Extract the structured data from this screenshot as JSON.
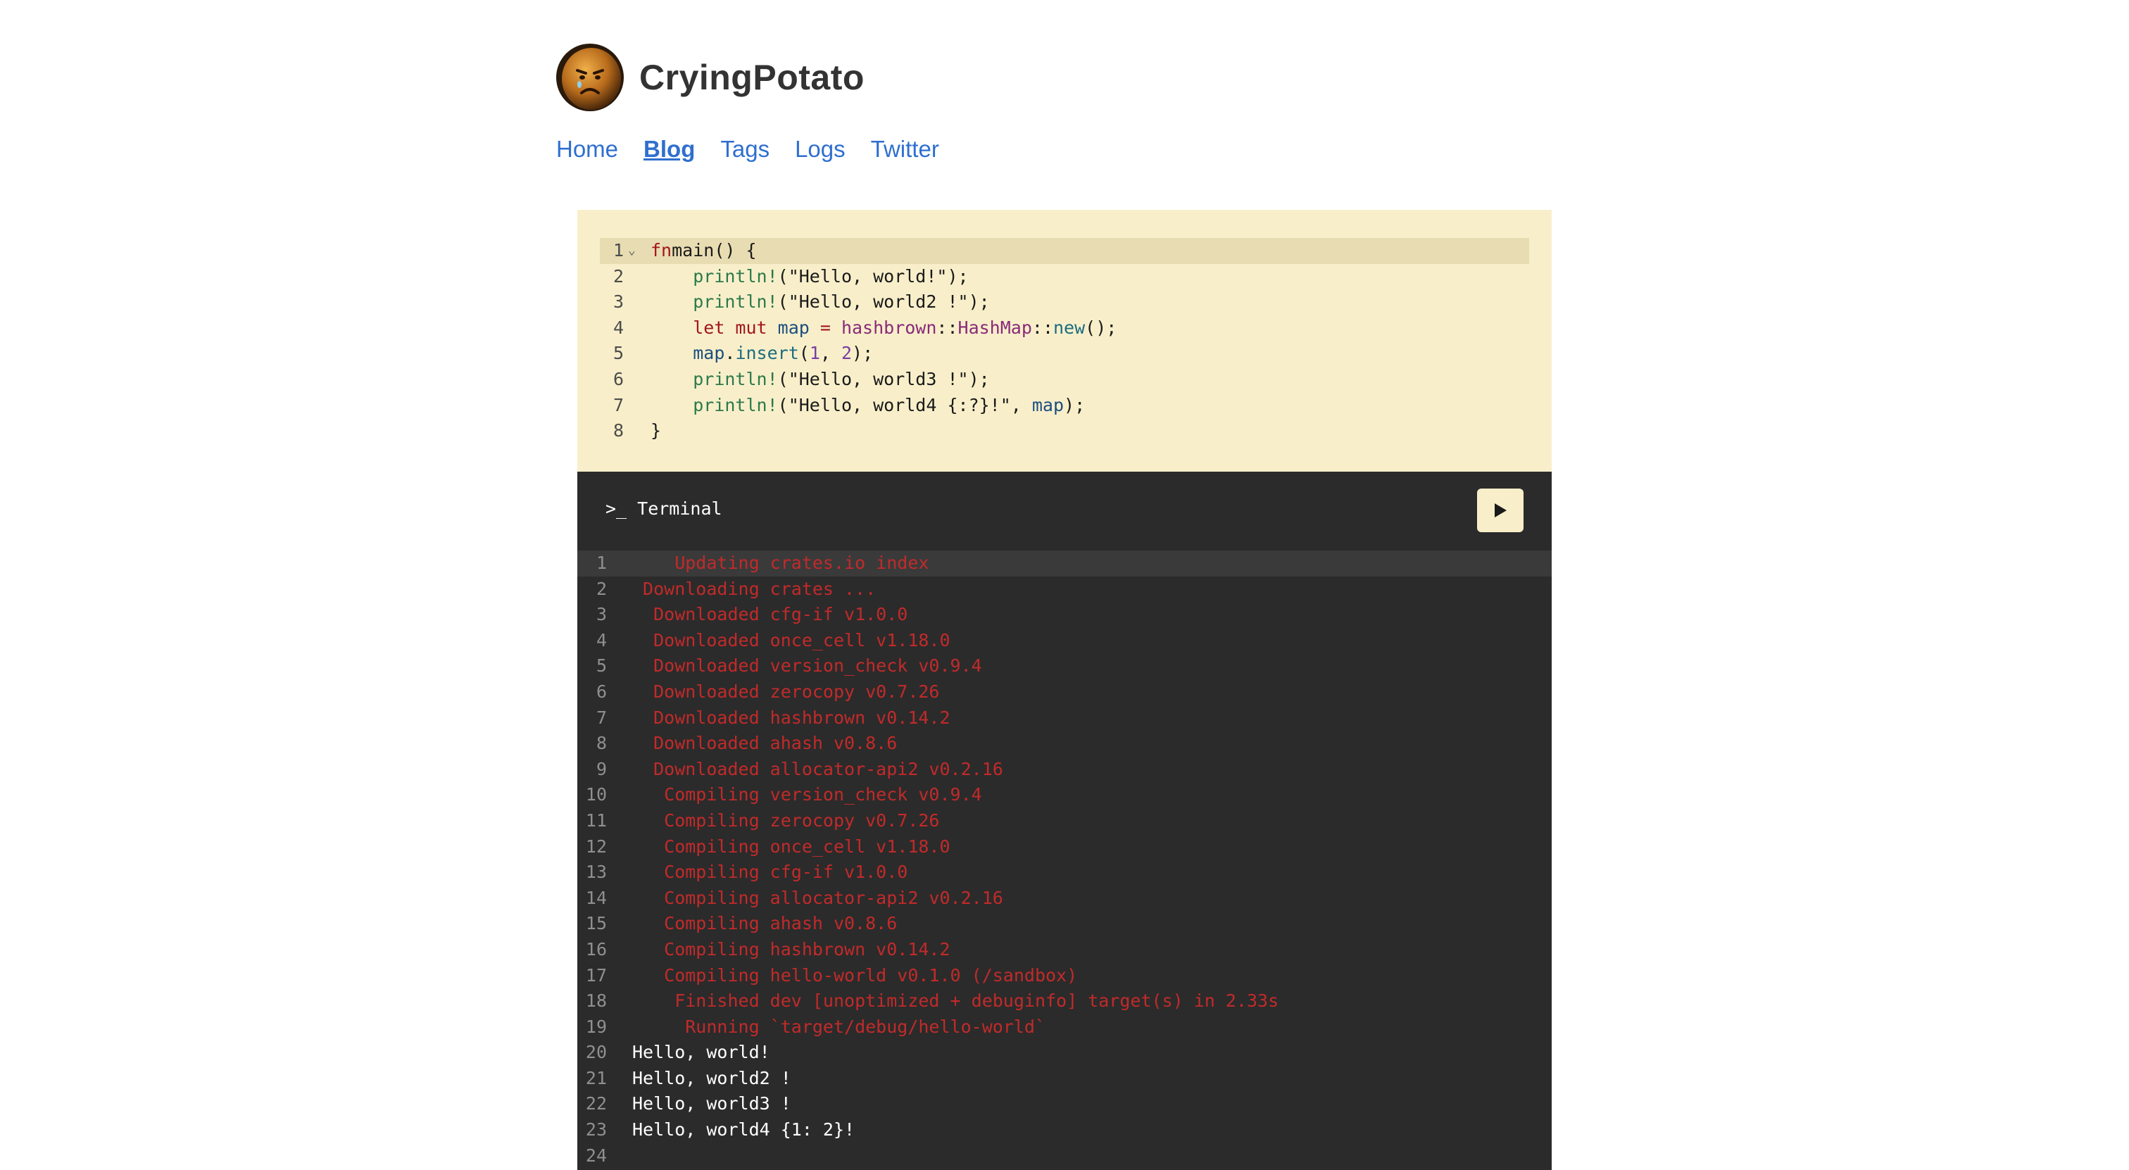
{
  "site": {
    "title": "CryingPotato",
    "nav": [
      "Home",
      "Blog",
      "Tags",
      "Logs",
      "Twitter"
    ],
    "active_nav": "Blog"
  },
  "editor": {
    "lines": [
      {
        "n": "1",
        "fold": "⌄",
        "active": true,
        "tokens": [
          [
            "kw",
            "fn"
          ],
          [
            "",
            "main"
          ],
          [
            "",
            "() {"
          ]
        ]
      },
      {
        "n": "2",
        "tokens": [
          [
            "",
            "    "
          ],
          [
            "fn",
            "println!"
          ],
          [
            "str",
            "(\"Hello, world!\");"
          ]
        ]
      },
      {
        "n": "3",
        "tokens": [
          [
            "",
            "    "
          ],
          [
            "fn",
            "println!"
          ],
          [
            "str",
            "(\"Hello, world2 !\");"
          ]
        ]
      },
      {
        "n": "4",
        "tokens": [
          [
            "",
            "    "
          ],
          [
            "kw",
            "let mut "
          ],
          [
            "var",
            "map"
          ],
          [
            "",
            ""
          ],
          [
            "kw",
            " = "
          ],
          [
            "type",
            "hashbrown"
          ],
          [
            "",
            "::"
          ],
          [
            "type",
            "HashMap"
          ],
          [
            "",
            "::"
          ],
          [
            "method",
            "new"
          ],
          [
            "",
            "();"
          ]
        ]
      },
      {
        "n": "5",
        "tokens": [
          [
            "",
            "    "
          ],
          [
            "var",
            "map"
          ],
          [
            "",
            "."
          ],
          [
            "method",
            "insert"
          ],
          [
            "",
            "("
          ],
          [
            "num",
            "1"
          ],
          [
            "",
            ", "
          ],
          [
            "num",
            "2"
          ],
          [
            "",
            ");"
          ]
        ]
      },
      {
        "n": "6",
        "tokens": [
          [
            "",
            "    "
          ],
          [
            "fn",
            "println!"
          ],
          [
            "str",
            "(\"Hello, world3 !\");"
          ]
        ]
      },
      {
        "n": "7",
        "tokens": [
          [
            "",
            "    "
          ],
          [
            "fn",
            "println!"
          ],
          [
            "str",
            "(\"Hello, world4 {:?}!\", "
          ],
          [
            "var",
            "map"
          ],
          [
            "",
            ");"
          ]
        ]
      },
      {
        "n": "8",
        "tokens": [
          [
            "",
            "}"
          ]
        ]
      }
    ]
  },
  "terminal": {
    "title": ">_ Terminal",
    "run_icon": "play-icon",
    "lines": [
      {
        "n": "1",
        "kind": "err",
        "text": "    Updating crates.io index",
        "active": true
      },
      {
        "n": "2",
        "kind": "err",
        "text": " Downloading crates ..."
      },
      {
        "n": "3",
        "kind": "err",
        "text": "  Downloaded cfg-if v1.0.0"
      },
      {
        "n": "4",
        "kind": "err",
        "text": "  Downloaded once_cell v1.18.0"
      },
      {
        "n": "5",
        "kind": "err",
        "text": "  Downloaded version_check v0.9.4"
      },
      {
        "n": "6",
        "kind": "err",
        "text": "  Downloaded zerocopy v0.7.26"
      },
      {
        "n": "7",
        "kind": "err",
        "text": "  Downloaded hashbrown v0.14.2"
      },
      {
        "n": "8",
        "kind": "err",
        "text": "  Downloaded ahash v0.8.6"
      },
      {
        "n": "9",
        "kind": "err",
        "text": "  Downloaded allocator-api2 v0.2.16"
      },
      {
        "n": "10",
        "kind": "err",
        "text": "   Compiling version_check v0.9.4"
      },
      {
        "n": "11",
        "kind": "err",
        "text": "   Compiling zerocopy v0.7.26"
      },
      {
        "n": "12",
        "kind": "err",
        "text": "   Compiling once_cell v1.18.0"
      },
      {
        "n": "13",
        "kind": "err",
        "text": "   Compiling cfg-if v1.0.0"
      },
      {
        "n": "14",
        "kind": "err",
        "text": "   Compiling allocator-api2 v0.2.16"
      },
      {
        "n": "15",
        "kind": "err",
        "text": "   Compiling ahash v0.8.6"
      },
      {
        "n": "16",
        "kind": "err",
        "text": "   Compiling hashbrown v0.14.2"
      },
      {
        "n": "17",
        "kind": "err",
        "text": "   Compiling hello-world v0.1.0 (/sandbox)"
      },
      {
        "n": "18",
        "kind": "err",
        "text": "    Finished dev [unoptimized + debuginfo] target(s) in 2.33s"
      },
      {
        "n": "19",
        "kind": "err",
        "text": "     Running `target/debug/hello-world`"
      },
      {
        "n": "20",
        "kind": "out",
        "text": "Hello, world!"
      },
      {
        "n": "21",
        "kind": "out",
        "text": "Hello, world2 !"
      },
      {
        "n": "22",
        "kind": "out",
        "text": "Hello, world3 !"
      },
      {
        "n": "23",
        "kind": "out",
        "text": "Hello, world4 {1: 2}!"
      },
      {
        "n": "24",
        "kind": "out",
        "text": ""
      }
    ]
  },
  "colors": {
    "link": "#2f6fcf",
    "editor_bg": "#f8efca",
    "terminal_bg": "#2b2b2b",
    "stderr": "#c22a2a",
    "stdout": "#ffffff"
  }
}
